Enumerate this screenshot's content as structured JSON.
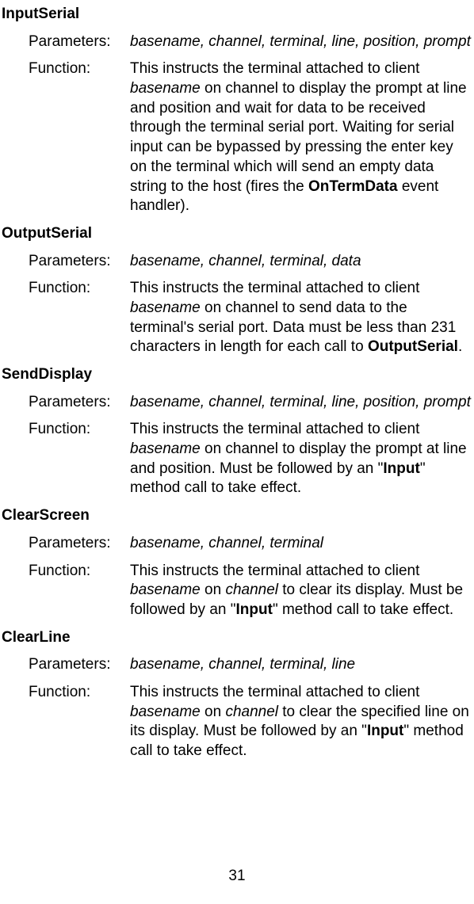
{
  "methods": [
    {
      "title": "InputSerial",
      "parameters_label": "Parameters:",
      "parameters": "basename, channel, terminal, line, position, prompt",
      "function_label": "Function:",
      "function_parts": [
        {
          "t": "text",
          "v": "This instructs the terminal attached to client "
        },
        {
          "t": "italic",
          "v": "basename"
        },
        {
          "t": "text",
          "v": " on channel to display the prompt at line and position and wait for data to be received through the terminal serial port. Waiting for serial input can be bypassed by pressing the enter key on the terminal which will send an empty data string to the host (fires the "
        },
        {
          "t": "bold",
          "v": "OnTermData"
        },
        {
          "t": "text",
          "v": " event handler)."
        }
      ]
    },
    {
      "title": "OutputSerial",
      "parameters_label": "Parameters:",
      "parameters": "basename, channel, terminal, data",
      "function_label": "Function:",
      "function_parts": [
        {
          "t": "text",
          "v": "This instructs the terminal attached to client "
        },
        {
          "t": "italic",
          "v": "basename"
        },
        {
          "t": "text",
          "v": " on channel to send data to the terminal's serial port. Data must be less than 231 characters in length for each call to "
        },
        {
          "t": "bold",
          "v": "OutputSerial"
        },
        {
          "t": "text",
          "v": "."
        }
      ]
    },
    {
      "title": "SendDisplay",
      "parameters_label": "Parameters:",
      "parameters": "basename, channel, terminal, line, position, prompt",
      "function_label": "Function:",
      "function_parts": [
        {
          "t": "text",
          "v": "This instructs the terminal attached to client "
        },
        {
          "t": "italic",
          "v": "basename"
        },
        {
          "t": "text",
          "v": " on channel to display the prompt at line and position. Must be followed by an \""
        },
        {
          "t": "bold",
          "v": "Input"
        },
        {
          "t": "text",
          "v": "\" method call to take effect."
        }
      ]
    },
    {
      "title": "ClearScreen",
      "parameters_label": "Parameters:",
      "parameters": "basename, channel, terminal",
      "function_label": "Function:",
      "function_parts": [
        {
          "t": "text",
          "v": "This instructs the terminal attached to client "
        },
        {
          "t": "italic",
          "v": "basename"
        },
        {
          "t": "text",
          "v": " on "
        },
        {
          "t": "italic",
          "v": "channel"
        },
        {
          "t": "text",
          "v": " to clear its display. Must be followed by an \""
        },
        {
          "t": "bold",
          "v": "Input"
        },
        {
          "t": "text",
          "v": "\" method call to take effect."
        }
      ]
    },
    {
      "title": "ClearLine",
      "parameters_label": "Parameters:",
      "parameters": "basename, channel, terminal, line",
      "function_label": "Function:",
      "function_parts": [
        {
          "t": "text",
          "v": "This instructs the terminal attached to client "
        },
        {
          "t": "italic",
          "v": "basename"
        },
        {
          "t": "text",
          "v": " on "
        },
        {
          "t": "italic",
          "v": "channel"
        },
        {
          "t": "text",
          "v": " to clear the specified line on its display. Must be followed by an \""
        },
        {
          "t": "bold",
          "v": "Input"
        },
        {
          "t": "text",
          "v": "\" method call to take effect."
        }
      ]
    }
  ],
  "page_number": "31"
}
